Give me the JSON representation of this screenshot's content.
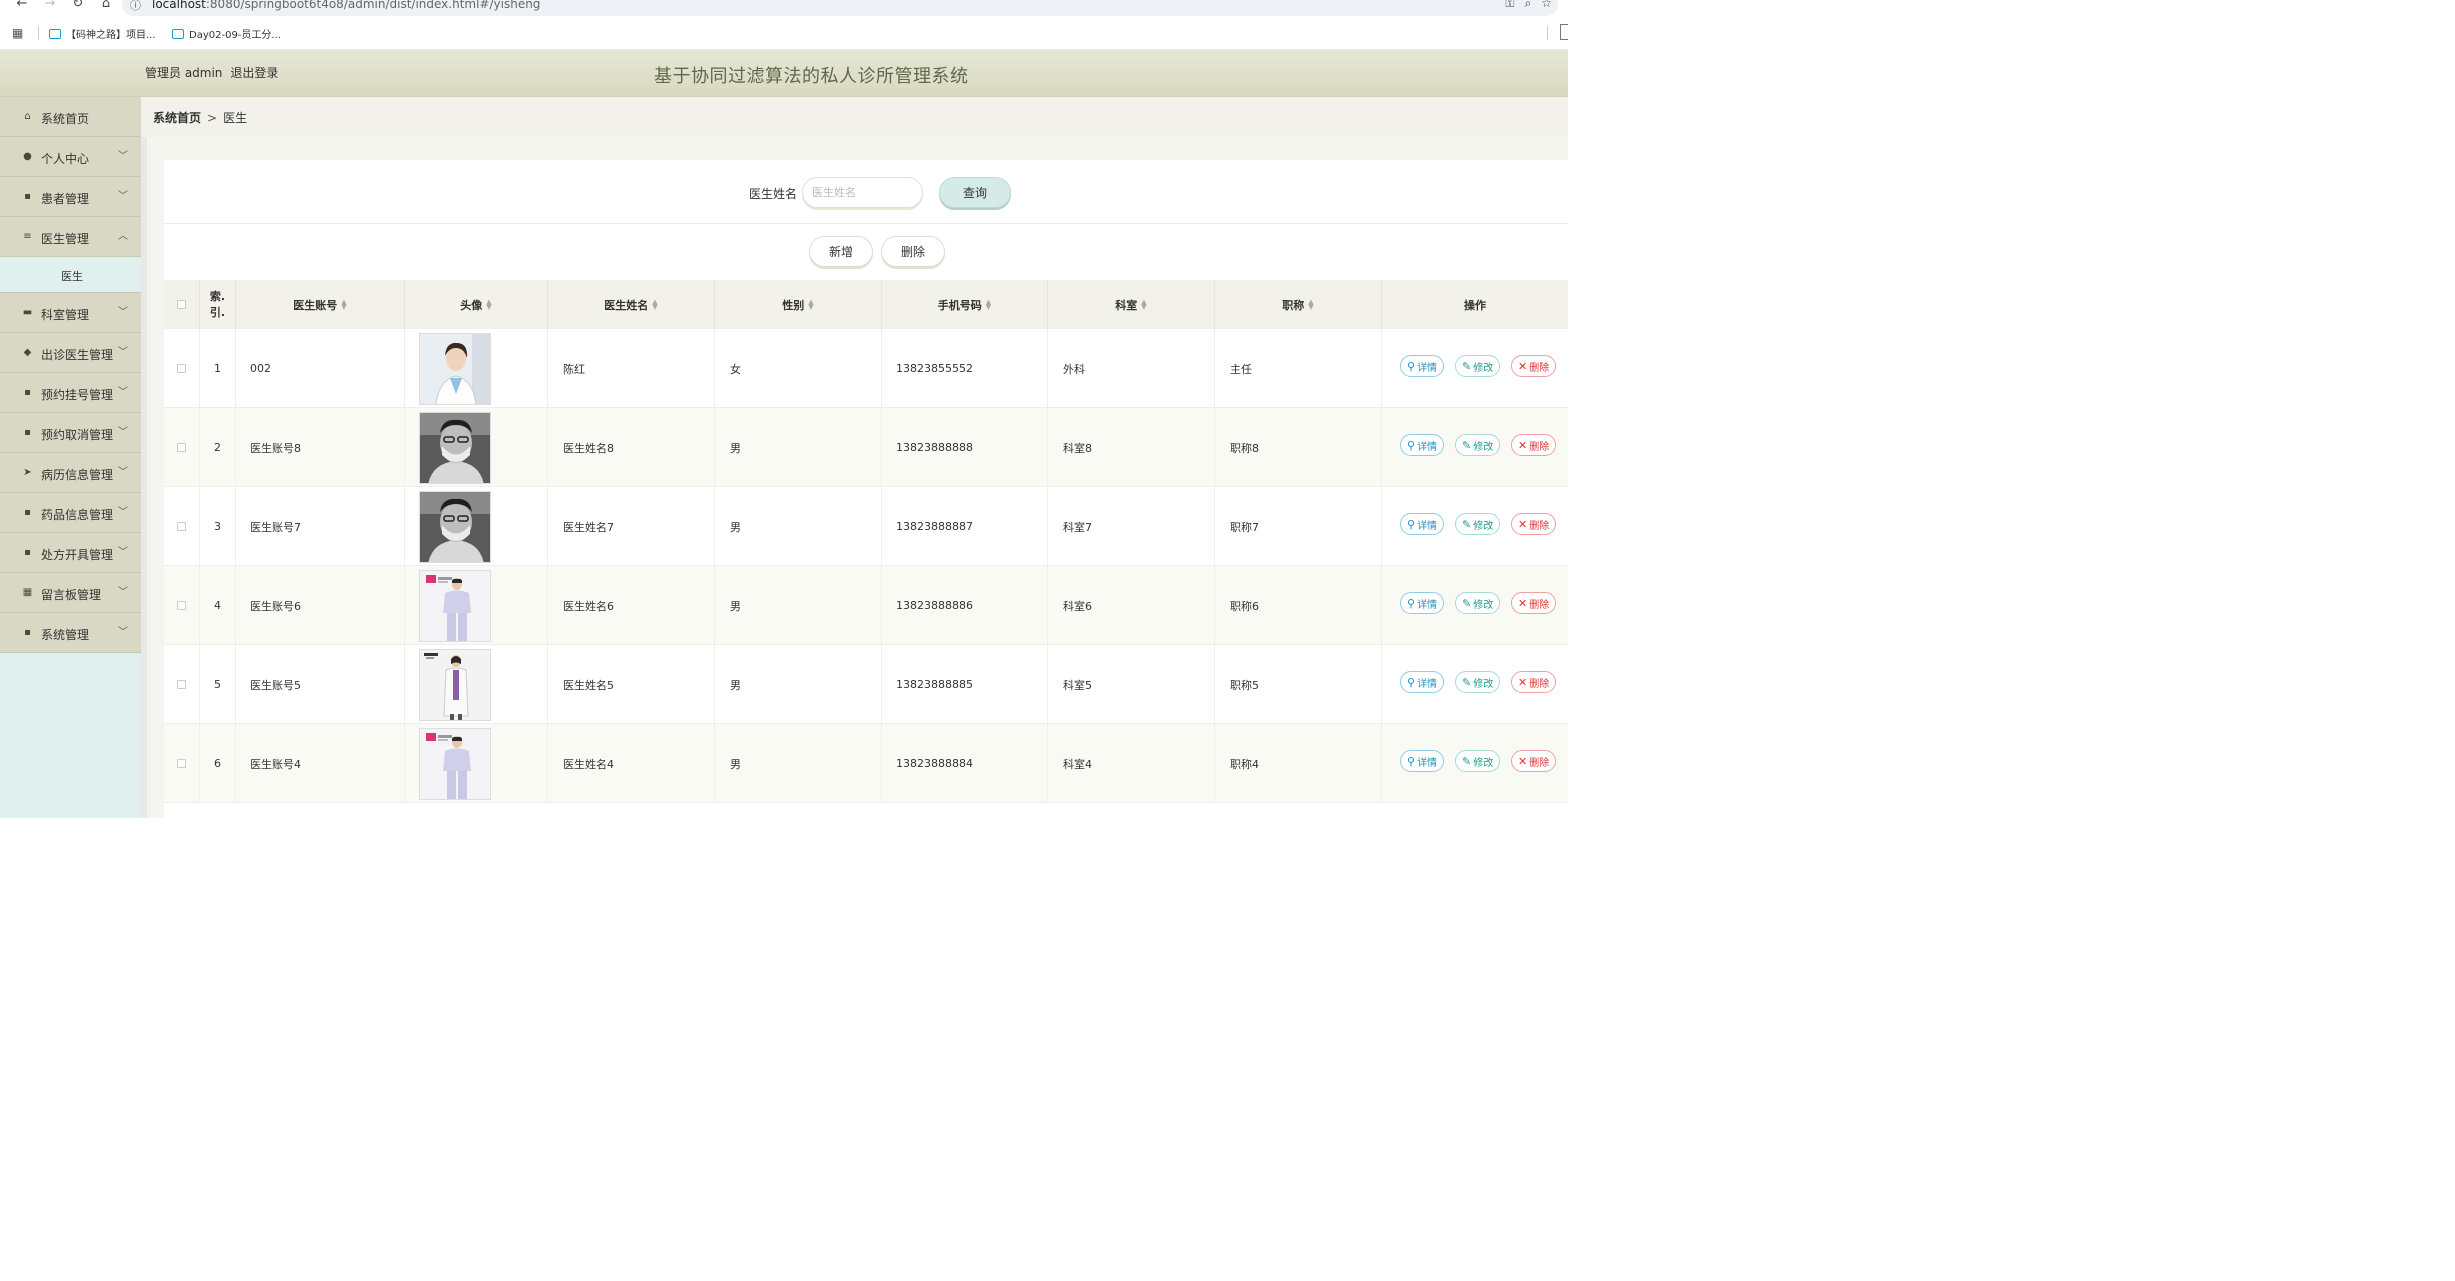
{
  "browser": {
    "url_host": "localhost",
    "url_rest": ":8080/springboot6t4o8/admin/dist/index.html#/yisheng",
    "bookmarks": [
      "【码神之路】项目...",
      "Day02-09-员工分..."
    ]
  },
  "header": {
    "admin_label": "管理员 admin",
    "logout_label": "退出登录",
    "title": "基于协同过滤算法的私人诊所管理系统"
  },
  "sidebar": {
    "items": [
      {
        "label": "系统首页",
        "icon": "home-icon",
        "has_chevron": false
      },
      {
        "label": "个人中心",
        "icon": "user-icon",
        "has_chevron": true
      },
      {
        "label": "患者管理",
        "icon": "grid-icon",
        "has_chevron": true
      },
      {
        "label": "医生管理",
        "icon": "sliders-icon",
        "has_chevron": true,
        "expanded": true
      },
      {
        "label": "科室管理",
        "icon": "monitor-icon",
        "has_chevron": true
      },
      {
        "label": "出诊医生管理",
        "icon": "pin-icon",
        "has_chevron": true
      },
      {
        "label": "预约挂号管理",
        "icon": "grid-icon",
        "has_chevron": true
      },
      {
        "label": "预约取消管理",
        "icon": "grid-icon",
        "has_chevron": true
      },
      {
        "label": "病历信息管理",
        "icon": "send-icon",
        "has_chevron": true
      },
      {
        "label": "药品信息管理",
        "icon": "grid-icon",
        "has_chevron": true
      },
      {
        "label": "处方开具管理",
        "icon": "grid-icon",
        "has_chevron": true
      },
      {
        "label": "留言板管理",
        "icon": "grid9-icon",
        "has_chevron": true
      },
      {
        "label": "系统管理",
        "icon": "grid-icon",
        "has_chevron": true
      }
    ],
    "submenu_label": "医生"
  },
  "breadcrumb": {
    "home": "系统首页",
    "separator": ">",
    "current": "医生"
  },
  "search": {
    "label": "医生姓名",
    "placeholder": "医生姓名",
    "query_button": "查询"
  },
  "actions": {
    "add": "新增",
    "delete": "删除"
  },
  "table": {
    "columns": [
      "索引",
      "医生账号",
      "头像",
      "医生姓名",
      "性别",
      "手机号码",
      "科室",
      "职称",
      "操作"
    ],
    "index_header_line1": "索.",
    "index_header_line2": "引.",
    "row_actions": {
      "detail": "详情",
      "edit": "修改",
      "remove": "删除"
    },
    "rows": [
      {
        "index": "1",
        "account": "002",
        "name": "陈红",
        "gender": "女",
        "phone": "13823855552",
        "dept": "外科",
        "title": "主任",
        "avatar": "female-doctor"
      },
      {
        "index": "2",
        "account": "医生账号8",
        "name": "医生姓名8",
        "gender": "男",
        "phone": "13823888888",
        "dept": "科室8",
        "title": "职称8",
        "avatar": "masked-doctor"
      },
      {
        "index": "3",
        "account": "医生账号7",
        "name": "医生姓名7",
        "gender": "男",
        "phone": "13823888887",
        "dept": "科室7",
        "title": "职称7",
        "avatar": "masked-doctor"
      },
      {
        "index": "4",
        "account": "医生账号6",
        "name": "医生姓名6",
        "gender": "男",
        "phone": "13823888886",
        "dept": "科室6",
        "title": "职称6",
        "avatar": "scrubs-doctor"
      },
      {
        "index": "5",
        "account": "医生账号5",
        "name": "医生姓名5",
        "gender": "男",
        "phone": "13823888885",
        "dept": "科室5",
        "title": "职称5",
        "avatar": "labcoat-doctor"
      },
      {
        "index": "6",
        "account": "医生账号4",
        "name": "医生姓名4",
        "gender": "男",
        "phone": "13823888884",
        "dept": "科室4",
        "title": "职称4",
        "avatar": "scrubs-doctor"
      }
    ]
  },
  "colors": {
    "header_bg": "#dcdcc6",
    "title_color": "#5c6b4a",
    "sidebar_item_bg": "#d8d8c4",
    "sidebar_bg": "#dff0ef",
    "query_button_bg": "#d5ebea",
    "detail_color": "#1e90c7",
    "edit_color": "#1f9a8a",
    "remove_color": "#dd3333"
  }
}
